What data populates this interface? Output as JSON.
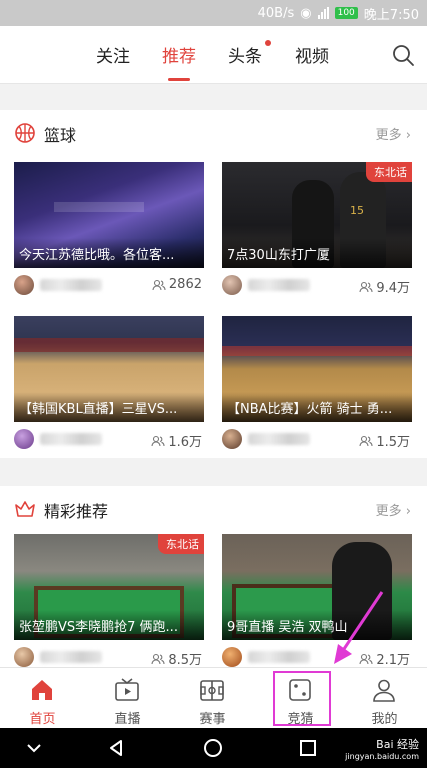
{
  "status_bar": {
    "speed": "40B/s",
    "time": "晚上7:50",
    "battery": "100"
  },
  "top_nav": {
    "tabs": [
      "关注",
      "推荐",
      "头条",
      "视频"
    ],
    "active_tab": "推荐"
  },
  "sections": [
    {
      "title": "篮球",
      "more": "更多",
      "cards": [
        {
          "title": "今天江苏德比哦。各位客...",
          "views": "2862",
          "corner": ""
        },
        {
          "title": "7点30山东打广厦",
          "views": "9.4万",
          "corner": "东北话"
        },
        {
          "title": "【韩国KBL直播】三星VS...",
          "views": "1.6万",
          "corner": ""
        },
        {
          "title": "【NBA比赛】火箭 骑士 勇...",
          "views": "1.5万",
          "corner": ""
        }
      ]
    },
    {
      "title": "精彩推荐",
      "more": "更多",
      "cards": [
        {
          "title": "张堃鹏VS李晓鹏抢7 俩跑...",
          "views": "8.5万",
          "corner": "东北话"
        },
        {
          "title": "9哥直播 吴浩  双鸭山",
          "views": "2.1万",
          "corner": ""
        }
      ]
    }
  ],
  "tab_bar": {
    "items": [
      "首页",
      "直播",
      "赛事",
      "竞猜",
      "我的"
    ],
    "active": "首页",
    "highlighted": "竞猜"
  },
  "watermark": {
    "line1": "Bai 经验",
    "line2": "jingyan.baidu.com"
  },
  "colors": {
    "accent": "#e0433c",
    "highlight": "#e03ad4"
  }
}
